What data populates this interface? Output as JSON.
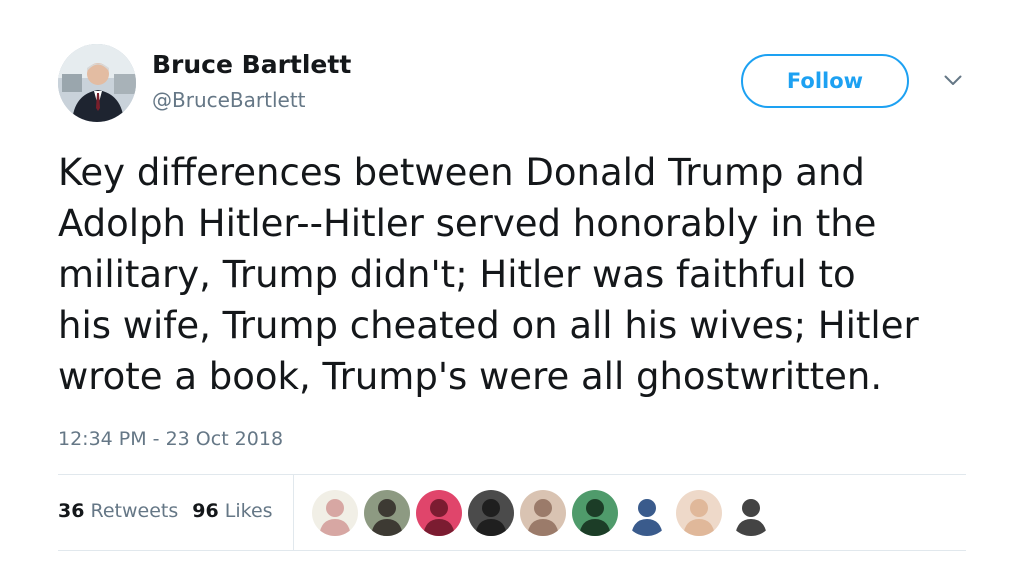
{
  "author": {
    "name": "Bruce Bartlett",
    "handle": "@BruceBartlett"
  },
  "follow_label": "Follow",
  "tweet": {
    "lines": [
      "Key differences between Donald Trump and",
      "Adolph Hitler--Hitler served honorably in the",
      "military, Trump didn't; Hitler was faithful to",
      "his wife, Trump cheated on all his wives; Hitler",
      "wrote a book, Trump's were all ghostwritten."
    ],
    "timestamp": "12:34 PM - 23 Oct 2018"
  },
  "stats": {
    "retweets_count": "36",
    "retweets_label": "Retweets",
    "likes_count": "96",
    "likes_label": "Likes"
  },
  "liker_avatars": [
    {
      "name": "liker-avatar-1",
      "bg": "#f1efe6",
      "fg": "#d7a7a3"
    },
    {
      "name": "liker-avatar-2",
      "bg": "#8d9a82",
      "fg": "#3d3a33"
    },
    {
      "name": "liker-avatar-3",
      "bg": "#e0456b",
      "fg": "#7b1c31"
    },
    {
      "name": "liker-avatar-4",
      "bg": "#4b4b4b",
      "fg": "#1f1f1f"
    },
    {
      "name": "liker-avatar-5",
      "bg": "#d9c3b2",
      "fg": "#9b7b6a"
    },
    {
      "name": "liker-avatar-6",
      "bg": "#4f9b6b",
      "fg": "#1c3d27"
    },
    {
      "name": "liker-avatar-7",
      "bg": "#ffffff",
      "fg": "#3a5b8c"
    },
    {
      "name": "liker-avatar-8",
      "bg": "#eed9c9",
      "fg": "#e0b89a"
    },
    {
      "name": "liker-avatar-9",
      "bg": "#ffffff",
      "fg": "#444444"
    }
  ],
  "colors": {
    "accent": "#1da1f2",
    "text": "#14171a",
    "secondary": "#657786",
    "divider": "#e1e8ed"
  }
}
